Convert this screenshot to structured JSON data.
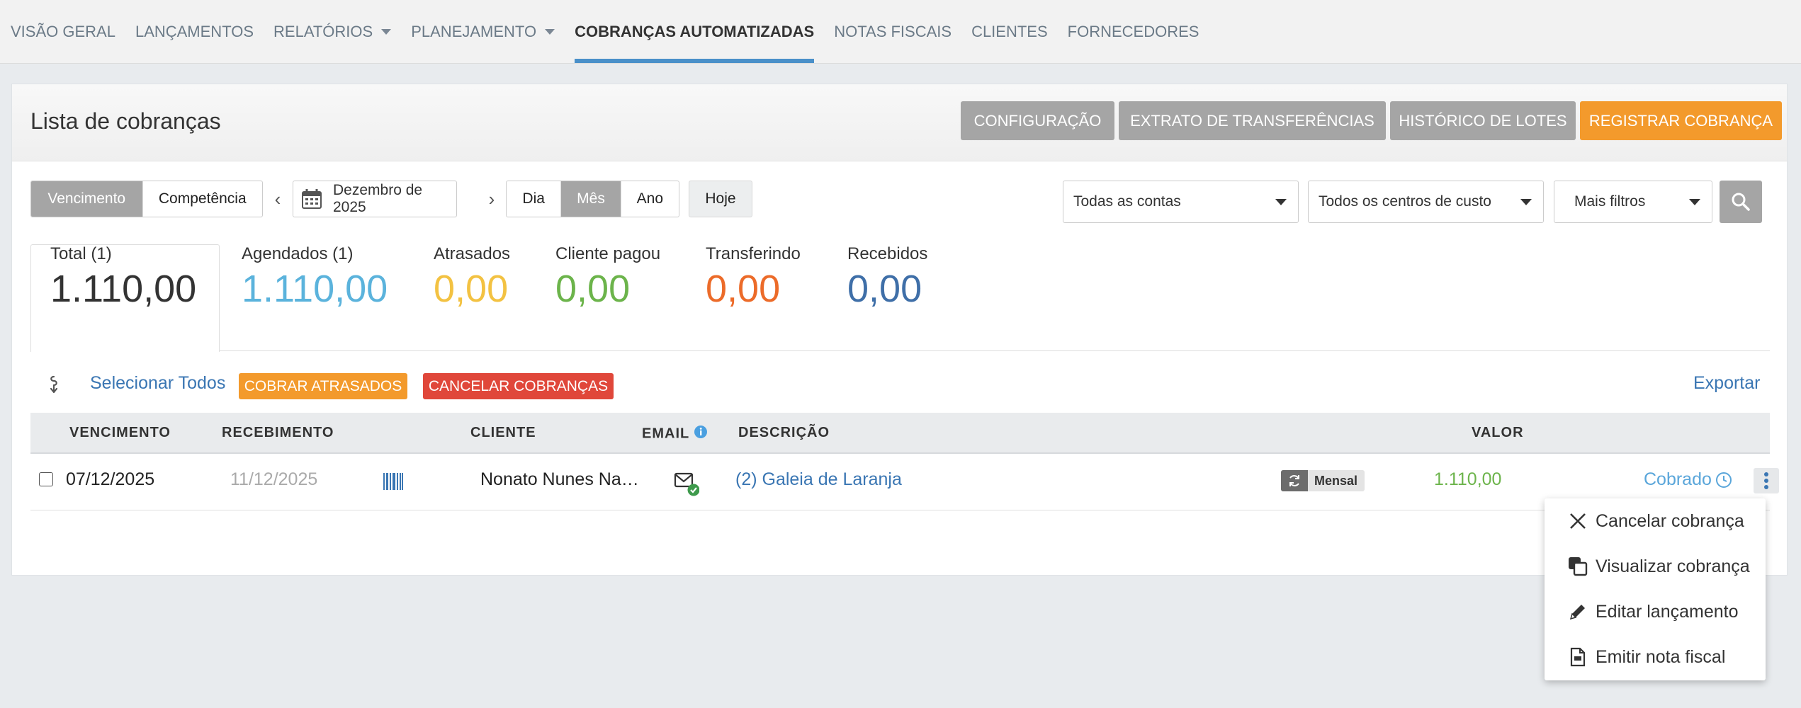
{
  "nav": [
    {
      "label": "VISÃO GERAL",
      "caret": false,
      "active": false
    },
    {
      "label": "LANÇAMENTOS",
      "caret": false,
      "active": false
    },
    {
      "label": "RELATÓRIOS",
      "caret": true,
      "active": false
    },
    {
      "label": "PLANEJAMENTO",
      "caret": true,
      "active": false
    },
    {
      "label": "COBRANÇAS AUTOMATIZADAS",
      "caret": false,
      "active": true
    },
    {
      "label": "NOTAS FISCAIS",
      "caret": false,
      "active": false
    },
    {
      "label": "CLIENTES",
      "caret": false,
      "active": false
    },
    {
      "label": "FORNECEDORES",
      "caret": false,
      "active": false
    }
  ],
  "header": {
    "title": "Lista de cobranças",
    "buttons": {
      "config": "CONFIGURAÇÃO",
      "extrato": "EXTRATO DE TRANSFERÊNCIAS",
      "historico": "HISTÓRICO DE LOTES",
      "registrar": "REGISTRAR COBRANÇA"
    }
  },
  "filters": {
    "date_type": {
      "vencimento": "Vencimento",
      "competencia": "Competência",
      "selected": "Vencimento"
    },
    "period": "Dezembro de 2025",
    "granularity": {
      "dia": "Dia",
      "mes": "Mês",
      "ano": "Ano",
      "selected": "Mês"
    },
    "today": "Hoje",
    "accounts": "Todas as contas",
    "cost_centers": "Todos os centros de custo",
    "more": "Mais filtros"
  },
  "summary": {
    "total": {
      "label": "Total (1)",
      "value": "1.110,00",
      "color": "#333333"
    },
    "agendados": {
      "label": "Agendados (1)",
      "value": "1.110,00",
      "color": "#5bb3dc"
    },
    "atrasados": {
      "label": "Atrasados",
      "value": "0,00",
      "color": "#f3c242"
    },
    "cliente_pagou": {
      "label": "Cliente pagou",
      "value": "0,00",
      "color": "#6cb44b"
    },
    "transferindo": {
      "label": "Transferindo",
      "value": "0,00",
      "color": "#ec6b29"
    },
    "recebidos": {
      "label": "Recebidos",
      "value": "0,00",
      "color": "#3f6fa8"
    }
  },
  "actions": {
    "select_all": "Selecionar Todos",
    "cobrar_atrasados": "COBRAR ATRASADOS",
    "cancelar_cobrancas": "CANCELAR COBRANÇAS",
    "exportar": "Exportar"
  },
  "table": {
    "headers": {
      "vencimento": "VENCIMENTO",
      "recebimento": "RECEBIMENTO",
      "cliente": "CLIENTE",
      "email": "EMAIL",
      "descricao": "DESCRIÇÃO",
      "valor": "VALOR"
    },
    "rows": [
      {
        "checked": false,
        "vencimento": "07/12/2025",
        "recebimento": "11/12/2025",
        "cliente": "Nonato Nunes Na…",
        "descricao": "(2) Galeia de Laranja",
        "recorrencia": "Mensal",
        "valor": "1.110,00",
        "status": "Cobrado"
      }
    ]
  },
  "menu": {
    "items": [
      {
        "label": "Cancelar cobrança",
        "icon": "close-icon"
      },
      {
        "label": "Visualizar cobrança",
        "icon": "copy-icon"
      },
      {
        "label": "Editar lançamento",
        "icon": "pencil-icon"
      },
      {
        "label": "Emitir nota fiscal",
        "icon": "invoice-icon"
      }
    ]
  },
  "colors": {
    "accent": "#4a90c9",
    "link": "#3a76b3",
    "orange": "#f39a2c",
    "red": "#e0473a",
    "value_green": "#6cb44b",
    "status_blue": "#5aa6da",
    "gray_button": "#a5a5a5"
  }
}
